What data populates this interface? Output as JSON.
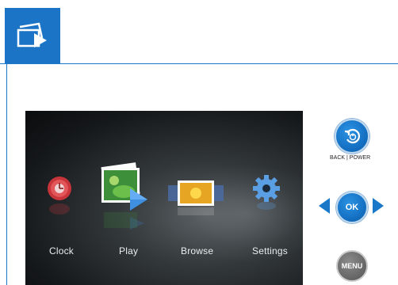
{
  "header": {
    "icon": "photo-slideshow-icon",
    "accent_color": "#1b74c6"
  },
  "screen": {
    "menu_items": [
      {
        "label": "Clock",
        "icon": "clock-icon"
      },
      {
        "label": "Play",
        "icon": "play-photos-icon"
      },
      {
        "label": "Browse",
        "icon": "browse-filmstrip-icon"
      },
      {
        "label": "Settings",
        "icon": "gear-icon"
      }
    ]
  },
  "controls": {
    "back_power_label": "BACK | POWER",
    "ok_label": "OK",
    "menu_label": "MENU"
  }
}
